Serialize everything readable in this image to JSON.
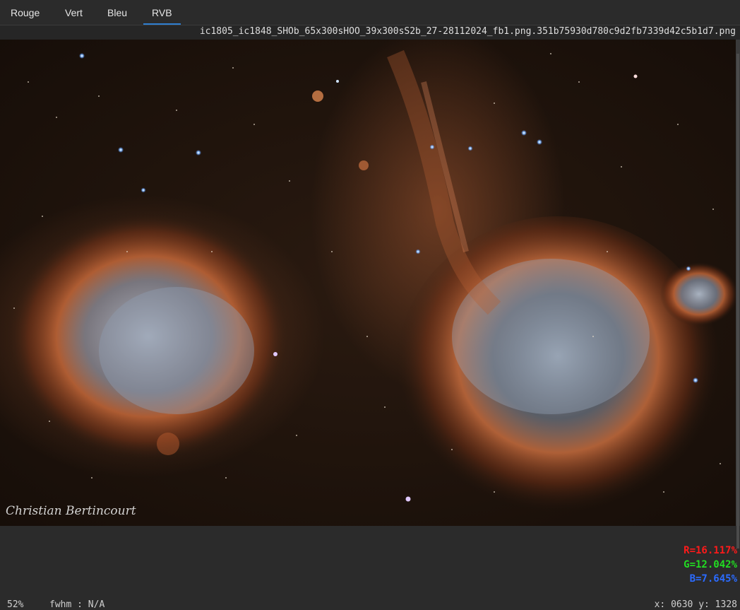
{
  "tabs": [
    {
      "label": "Rouge",
      "active": false
    },
    {
      "label": "Vert",
      "active": false
    },
    {
      "label": "Bleu",
      "active": false
    },
    {
      "label": "RVB",
      "active": true
    }
  ],
  "file_name": "ic1805_ic1848_SHOb_65x300sHOO_39x300sS2b_27-28112024_fb1.png.351b75930d780c9d2fb7339d42c5b1d7.png",
  "image": {
    "subject": "Heart and Soul nebulae (IC1805, IC1848)",
    "signature": "Christian Bertincourt"
  },
  "pixel_readout": {
    "r": "R=16.117%",
    "g": "G=12.042%",
    "b": "B=7.645%",
    "colors": {
      "r": "#ff1a1a",
      "g": "#22dd22",
      "b": "#2b6bff"
    }
  },
  "status": {
    "zoom": "52%",
    "fwhm": "fwhm : N/A",
    "coords": "x: 0630 y: 1328"
  }
}
